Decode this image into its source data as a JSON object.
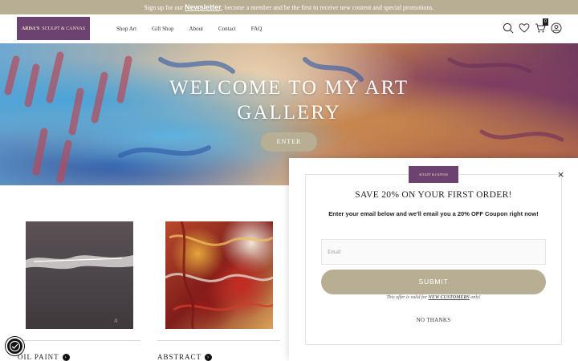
{
  "announcement": {
    "before": "Sign up for our ",
    "link": "Newsletter",
    "after": ", become a member and be the first to receive new content and special promotions."
  },
  "header": {
    "logo_line1": "ARDA'S",
    "logo_line2": "SCULPT & CANVAS",
    "nav": [
      "Shop Art",
      "Gift Shop",
      "About",
      "Contact",
      "FAQ"
    ],
    "cart_count": "0",
    "icons": [
      "search-icon",
      "heart-icon",
      "cart-icon",
      "account-icon"
    ]
  },
  "hero": {
    "title_line1": "WELCOME TO MY ART",
    "title_line2": "GALLERY",
    "button": "ENTER"
  },
  "products": [
    {
      "label": "OIL PAINT"
    },
    {
      "label": "ABSTRACT"
    }
  ],
  "popup": {
    "title": "SAVE 20% ON YOUR FIRST ORDER!",
    "description": "Enter your email below and we'll email you a 20% OFF Coupon right now!",
    "email_placeholder": "Email",
    "submit": "SUBMIT",
    "note_before": "This offer is valid for ",
    "note_link": "NEW CUSTOMERS",
    "note_after": " only!",
    "no_thanks": "NO THANKS",
    "close": "×"
  },
  "colors": {
    "accent": "#b7ae93",
    "logo_bg": "#6b4270"
  }
}
